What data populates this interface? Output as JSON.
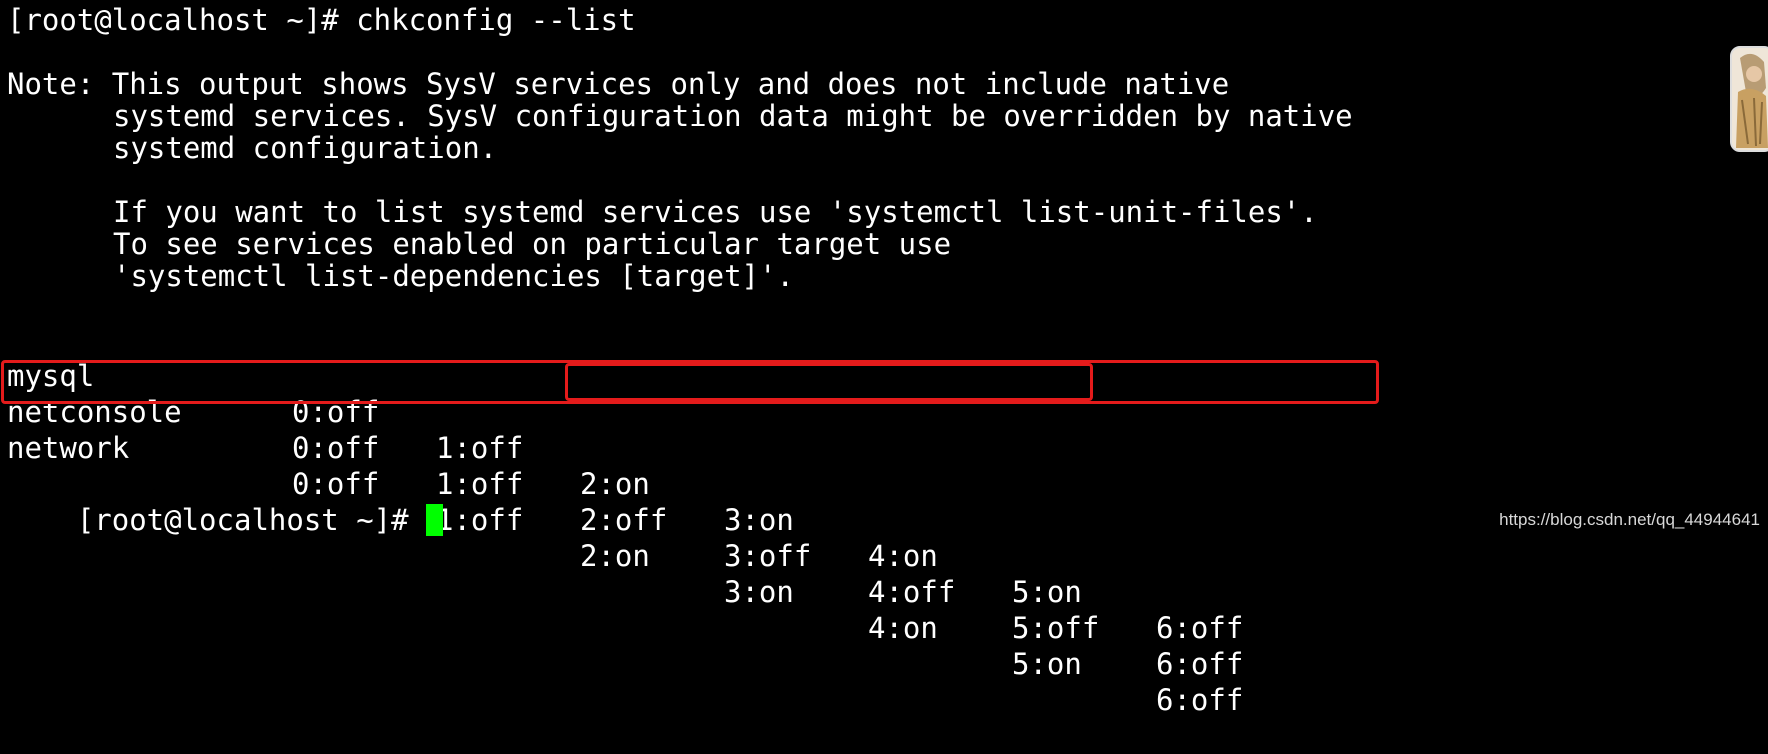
{
  "terminal": {
    "command_line": "[root@localhost ~]# chkconfig --list",
    "note_lines": [
      "Note: This output shows SysV services only and does not include native",
      "systemd services. SysV configuration data might be overridden by native",
      "systemd configuration.",
      "If you want to list systemd services use 'systemctl list-unit-files'.",
      "To see services enabled on particular target use",
      "'systemctl list-dependencies [target]'."
    ],
    "services": [
      {
        "name": "mysql",
        "levels": [
          "0:off",
          "1:off",
          "2:on",
          "3:on",
          "4:on",
          "5:on",
          "6:off"
        ]
      },
      {
        "name": "netconsole",
        "levels": [
          "0:off",
          "1:off",
          "2:off",
          "3:off",
          "4:off",
          "5:off",
          "6:off"
        ]
      },
      {
        "name": "network",
        "levels": [
          "0:off",
          "1:off",
          "2:on",
          "3:on",
          "4:on",
          "5:on",
          "6:off"
        ]
      }
    ],
    "prompt": "[root@localhost ~]# ",
    "cursor_color": "#00ff00",
    "highlight_color": "#e41b1b"
  },
  "watermark": "https://blog.csdn.net/qq_44944641"
}
